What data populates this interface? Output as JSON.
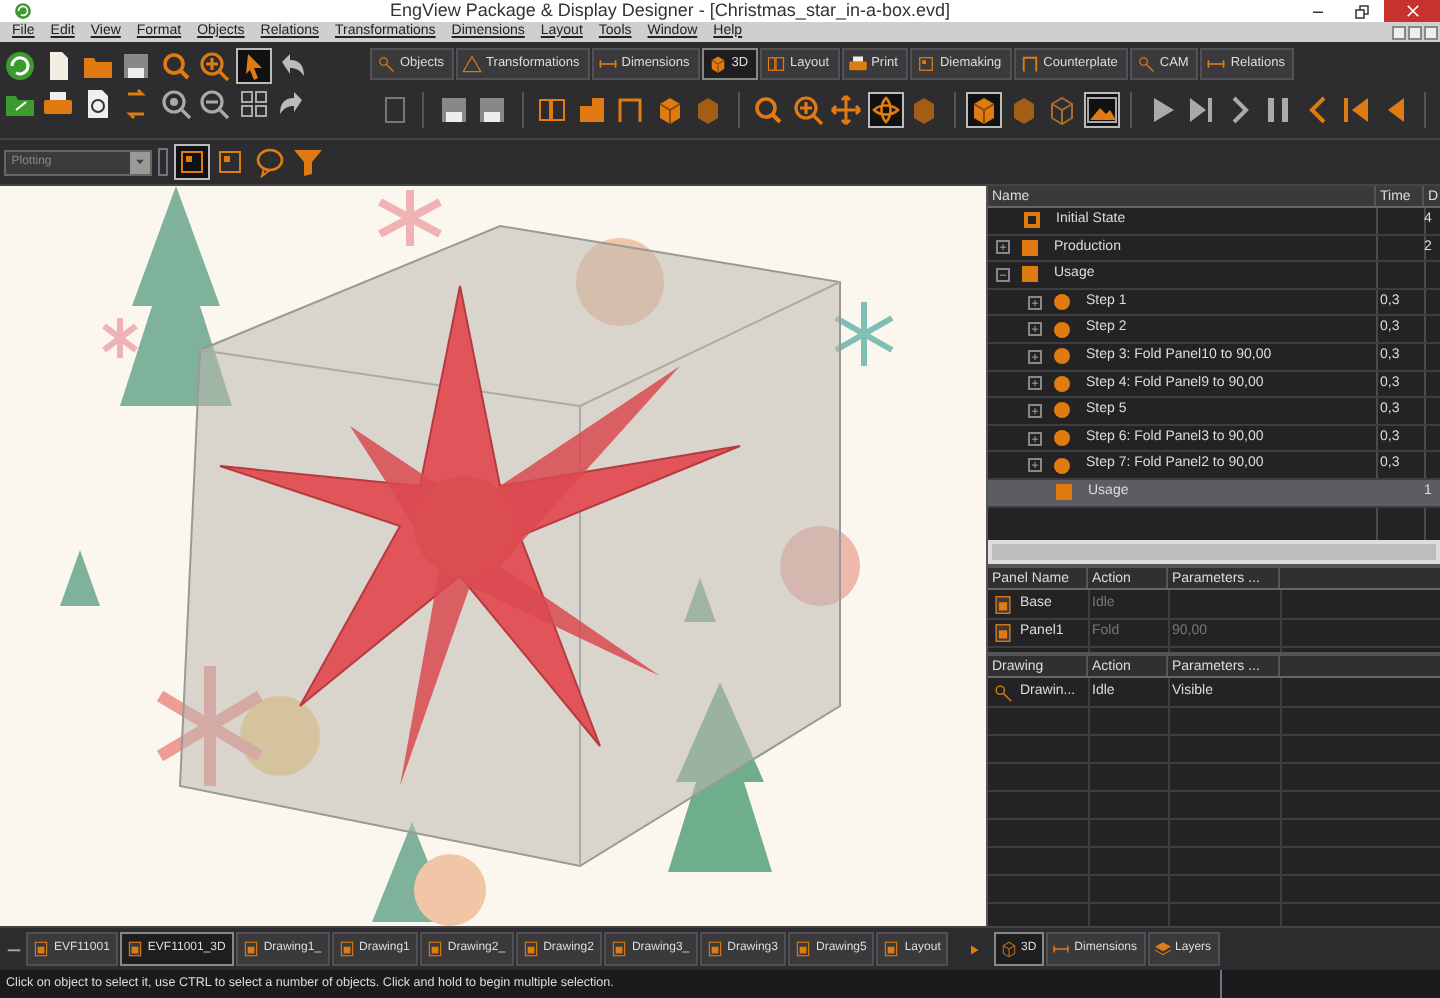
{
  "window": {
    "title": "EngView Package & Display Designer - [Christmas_star_in-a-box.evd]"
  },
  "menu": [
    "File",
    "Edit",
    "View",
    "Format",
    "Objects",
    "Relations",
    "Transformations",
    "Dimensions",
    "Layout",
    "Tools",
    "Window",
    "Help"
  ],
  "toolbar_tabs": [
    {
      "label": "Objects",
      "selected": false
    },
    {
      "label": "Transformations",
      "selected": false
    },
    {
      "label": "Dimensions",
      "selected": false
    },
    {
      "label": "3D",
      "selected": true
    },
    {
      "label": "Layout",
      "selected": false
    },
    {
      "label": "Print",
      "selected": false
    },
    {
      "label": "Diemaking",
      "selected": false
    },
    {
      "label": "Counterplate",
      "selected": false
    },
    {
      "label": "CAM",
      "selected": false
    },
    {
      "label": "Relations",
      "selected": false
    }
  ],
  "layer_dropdown": {
    "value": "Plotting",
    "disabled": true
  },
  "animation_tree": {
    "columns": [
      "Name",
      "Time",
      "D"
    ],
    "rows": [
      {
        "name": "Initial State",
        "kind": "state",
        "column_3": "4",
        "selected": false
      },
      {
        "name": "Production",
        "kind": "group",
        "expanded": false,
        "column_3": "2",
        "selected": false
      },
      {
        "name": "Usage",
        "kind": "group",
        "expanded": true,
        "selected": false,
        "children": [
          {
            "name": "Step 1",
            "kind": "step",
            "expanded": false,
            "time": "0,3",
            "selected": false
          },
          {
            "name": "Step 2",
            "kind": "step",
            "expanded": false,
            "time": "0,3",
            "selected": false
          },
          {
            "name": "Step 3: Fold Panel10 to 90,00",
            "kind": "step",
            "expanded": false,
            "time": "0,3",
            "selected": false
          },
          {
            "name": "Step 4: Fold Panel9 to 90,00",
            "kind": "step",
            "expanded": false,
            "time": "0,3",
            "selected": false
          },
          {
            "name": "Step 5",
            "kind": "step",
            "expanded": false,
            "time": "0,3",
            "selected": false
          },
          {
            "name": "Step 6: Fold Panel3 to 90,00",
            "kind": "step",
            "expanded": false,
            "time": "0,3",
            "selected": false
          },
          {
            "name": "Step 7: Fold Panel2 to 90,00",
            "kind": "step",
            "expanded": false,
            "time": "0,3",
            "selected": false
          },
          {
            "name": "Usage",
            "kind": "group",
            "column_3": "1",
            "selected": true
          }
        ]
      }
    ]
  },
  "panel_table": {
    "columns": [
      "Panel Name",
      "Action",
      "Parameters ..."
    ],
    "rows": [
      {
        "cells": [
          "Base",
          "Idle"
        ],
        "disabled": true
      },
      {
        "cells": [
          "Panel1",
          "Fold",
          "90,00"
        ],
        "disabled": true
      }
    ]
  },
  "drawing_table": {
    "columns": [
      "Drawing",
      "Action",
      "Parameters ..."
    ],
    "rows": [
      {
        "cells": [
          "Drawin...",
          "Idle",
          "Visible"
        ],
        "disabled": false
      }
    ]
  },
  "document_tabs": [
    {
      "label": "EVF11001",
      "selected": false
    },
    {
      "label": "EVF11001_3D",
      "selected": true
    },
    {
      "label": "Drawing1_",
      "selected": false
    },
    {
      "label": "Drawing1",
      "selected": false
    },
    {
      "label": "Drawing2_",
      "selected": false
    },
    {
      "label": "Drawing2",
      "selected": false
    },
    {
      "label": "Drawing3_",
      "selected": false
    },
    {
      "label": "Drawing3",
      "selected": false
    },
    {
      "label": "Drawing5",
      "selected": false
    },
    {
      "label": "Layout",
      "selected": false
    }
  ],
  "panel_tabs": [
    {
      "label": "3D",
      "selected": true
    },
    {
      "label": "Dimensions",
      "selected": false
    },
    {
      "label": "Layers",
      "selected": false
    }
  ],
  "status_bar": "Click on object to select it, use CTRL to select a number of objects. Click and hold to begin multiple selection."
}
